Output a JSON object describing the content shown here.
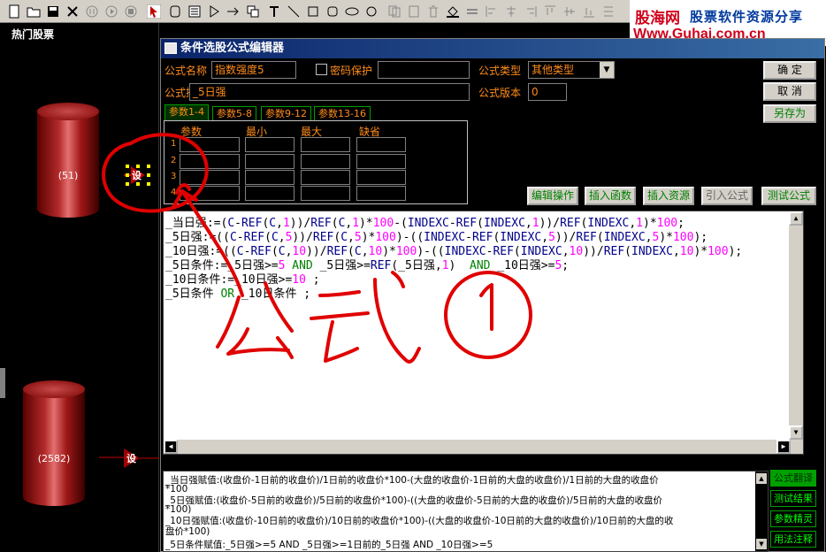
{
  "toolbar": {
    "icons": [
      "new-icon",
      "open-icon",
      "save-icon",
      "close-icon",
      "pause-icon",
      "stop-icon",
      "record-icon",
      "pointer-icon",
      "rectangle-icon",
      "line-icon",
      "text-icon",
      "ellipse-icon",
      "delete-icon"
    ]
  },
  "logo": {
    "brand": "股海网",
    "slogan": "股票软件资源分享",
    "url": "Www.Guhai.com.cn"
  },
  "left": {
    "title": "热门股票",
    "cylinders": [
      {
        "label": "(51)"
      },
      {
        "label": "(2582)"
      }
    ],
    "set_label": "设"
  },
  "dialog": {
    "title": "条件选股公式编辑器",
    "name_label": "公式名称",
    "name_value": "指数强度5",
    "password_label": "密码保护",
    "password_value": "",
    "type_label": "公式类型",
    "type_value": "其他类型",
    "desc_label": "公式描述",
    "desc_value": "_5日强",
    "version_label": "公式版本",
    "version_value": "0",
    "ok": "确  定",
    "cancel": "取  消",
    "save_as": "另存为",
    "tabs": [
      "参数1-4",
      "参数5-8",
      "参数9-12",
      "参数13-16"
    ],
    "param_headers": [
      "参数",
      "最小",
      "最大",
      "缺省"
    ],
    "param_rows": [
      "1",
      "2",
      "3",
      "4"
    ],
    "actions": [
      "编辑操作",
      "插入函数",
      "插入资源",
      "引入公式",
      "测试公式"
    ],
    "code_lines": [
      "_当日强:=(C-REF(C,1))/REF(C,1)*100-(INDEXC-REF(INDEXC,1))/REF(INDEXC,1)*100;",
      "_5日强:=((C-REF(C,5))/REF(C,5)*100)-((INDEXC-REF(INDEXC,5))/REF(INDEXC,5)*100);",
      "_10日强:=((C-REF(C,10))/REF(C,10)*100)-((INDEXC-REF(INDEXC,10))/REF(INDEXC,10)*100);",
      "_5日条件:=_5日强>=5 AND _5日强>=REF(_5日强,1)  AND _10日强>=5;",
      "_10日条件:=_10日强>=10 ;",
      "_5日条件 OR _10日条件 ;"
    ],
    "annotation_lines": [
      "_当日强赋值:(收盘价-1日前的收盘价)/1日前的收盘价*100-(大盘的收盘价-1日前的大盘的收盘价)/1日前的大盘的收盘价",
      "*100",
      "_5日强赋值:(收盘价-5日前的收盘价)/5日前的收盘价*100)-((大盘的收盘价-5日前的大盘的收盘价)/5日前的大盘的收盘价",
      "*100)",
      "_10日强赋值:(收盘价-10日前的收盘价)/10日前的收盘价*100)-((大盘的收盘价-10日前的大盘的收盘价)/10日前的大盘的收",
      "盘价*100)",
      "_5日条件赋值:_5日强>=5 AND _5日强>=1日前的_5日强  AND _10日强>=5"
    ],
    "side_buttons": [
      "公式翻译",
      "测试结果",
      "参数精灵",
      "用法注释"
    ]
  },
  "handwriting": "公式①",
  "colors": {
    "label": "#ff8c1a",
    "accent": "#00a000",
    "title_bar": "#0a246a",
    "ink": "#e00000"
  }
}
